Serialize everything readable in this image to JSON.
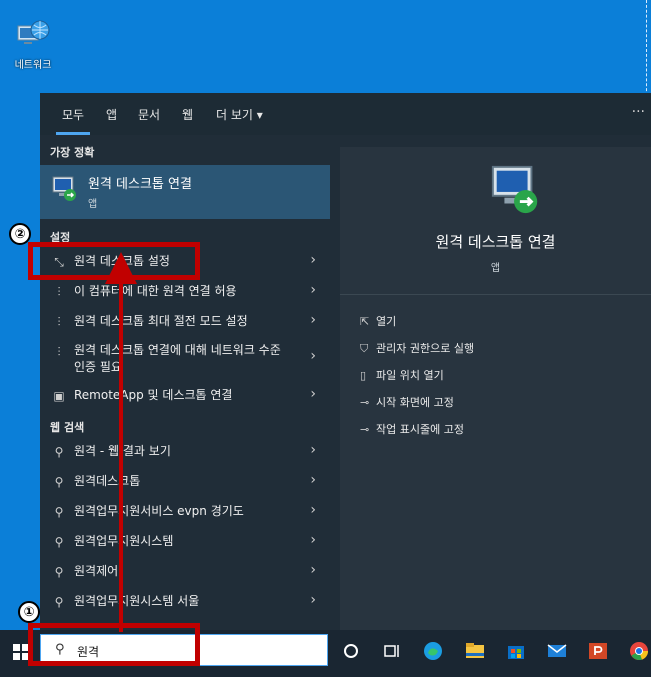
{
  "desktop": {
    "network_label": "네트워크"
  },
  "filters": {
    "all": "모두",
    "apps": "앱",
    "documents": "문서",
    "web": "웹",
    "more": "더 보기 ▾",
    "overflow": "···"
  },
  "sections": {
    "best_match": "가장 정확",
    "settings": "설정",
    "web_search": "웹 검색"
  },
  "best_match": {
    "title": "원격 데스크톱 연결",
    "subtitle": "앱"
  },
  "settings_items": [
    {
      "label": "원격 데스크톱 설정"
    },
    {
      "label": "이 컴퓨터에 대한 원격 연결 허용"
    },
    {
      "label": "원격 데스크톱 최대 절전 모드 설정"
    },
    {
      "label": "원격 데스크톱 연결에 대해 네트워크 수준 인증 필요"
    },
    {
      "label": "RemoteApp 및 데스크톱 연결"
    }
  ],
  "web_items": [
    {
      "label": "원격 - 웹 결과 보기"
    },
    {
      "label": "원격데스크톱"
    },
    {
      "label": "원격업무지원서비스 evpn 경기도"
    },
    {
      "label": "원격업무지원시스템"
    },
    {
      "label": "원격제어"
    },
    {
      "label": "원격업무지원시스템 서울"
    }
  ],
  "preview": {
    "title": "원격 데스크톱 연결",
    "subtitle": "앱",
    "actions": [
      {
        "label": "열기",
        "icon": "open-icon"
      },
      {
        "label": "관리자 권한으로 실행",
        "icon": "shield-icon"
      },
      {
        "label": "파일 위치 열기",
        "icon": "file-location-icon"
      },
      {
        "label": "시작 화면에 고정",
        "icon": "pin-icon"
      },
      {
        "label": "작업 표시줄에 고정",
        "icon": "pin-icon"
      }
    ]
  },
  "taskbar": {
    "search_value": "원격"
  },
  "annotations": {
    "marker_1": "①",
    "marker_2": "②"
  },
  "colors": {
    "desktop": "#0b7fd8",
    "panel": "#202d38",
    "selected": "#2b5675",
    "accent": "#4ea6f1",
    "annotation": "#c10000"
  }
}
